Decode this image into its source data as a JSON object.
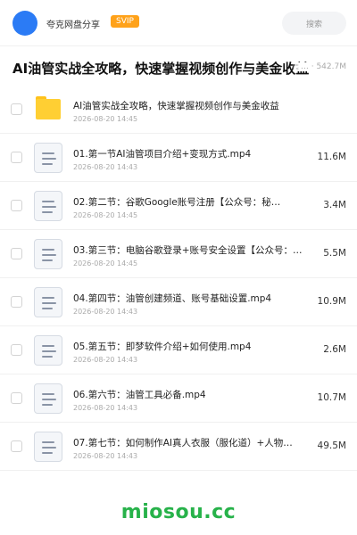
{
  "header": {
    "username": "夸克网盘分享",
    "badge": "SVIP",
    "search_placeholder": "搜索"
  },
  "folder": {
    "title": "AI油管实战全攻略，快速掌握视频创作与美金收益",
    "meta": "… · 542.7M"
  },
  "items": [
    {
      "type": "folder",
      "name": "AI油管实战全攻略，快速掌握视频创作与美金收益",
      "date": "2026-08-20 14:45",
      "size": ""
    },
    {
      "type": "video",
      "name": "01.第一节AI油管项目介绍+变现方式.mp4",
      "date": "2026-08-20 14:43",
      "size": "11.6M"
    },
    {
      "type": "video",
      "name": "02.第二节：谷歌Google账号注册【公众号：秘…",
      "date": "2026-08-20 14:45",
      "size": "3.4M"
    },
    {
      "type": "video",
      "name": "03.第三节：电脑谷歌登录+账号安全设置【公众号：…",
      "date": "2026-08-20 14:45",
      "size": "5.5M"
    },
    {
      "type": "video",
      "name": "04.第四节：油管创建频道、账号基础设置.mp4",
      "date": "2026-08-20 14:43",
      "size": "10.9M"
    },
    {
      "type": "video",
      "name": "05.第五节：即梦软件介绍+如何使用.mp4",
      "date": "2026-08-20 14:43",
      "size": "2.6M"
    },
    {
      "type": "video",
      "name": "06.第六节：油管工具必备.mp4",
      "date": "2026-08-20 14:43",
      "size": "10.7M"
    },
    {
      "type": "video",
      "name": "07.第七节：如何制作AI真人衣服（服化道）+人物…",
      "date": "2026-08-20 14:43",
      "size": "49.5M"
    }
  ],
  "watermark": "miosou.cc",
  "colors": {
    "accent": "#2b7bf5",
    "svip": "#ffa21a",
    "folder": "#ffcf33",
    "watermark": "#27b24a"
  }
}
